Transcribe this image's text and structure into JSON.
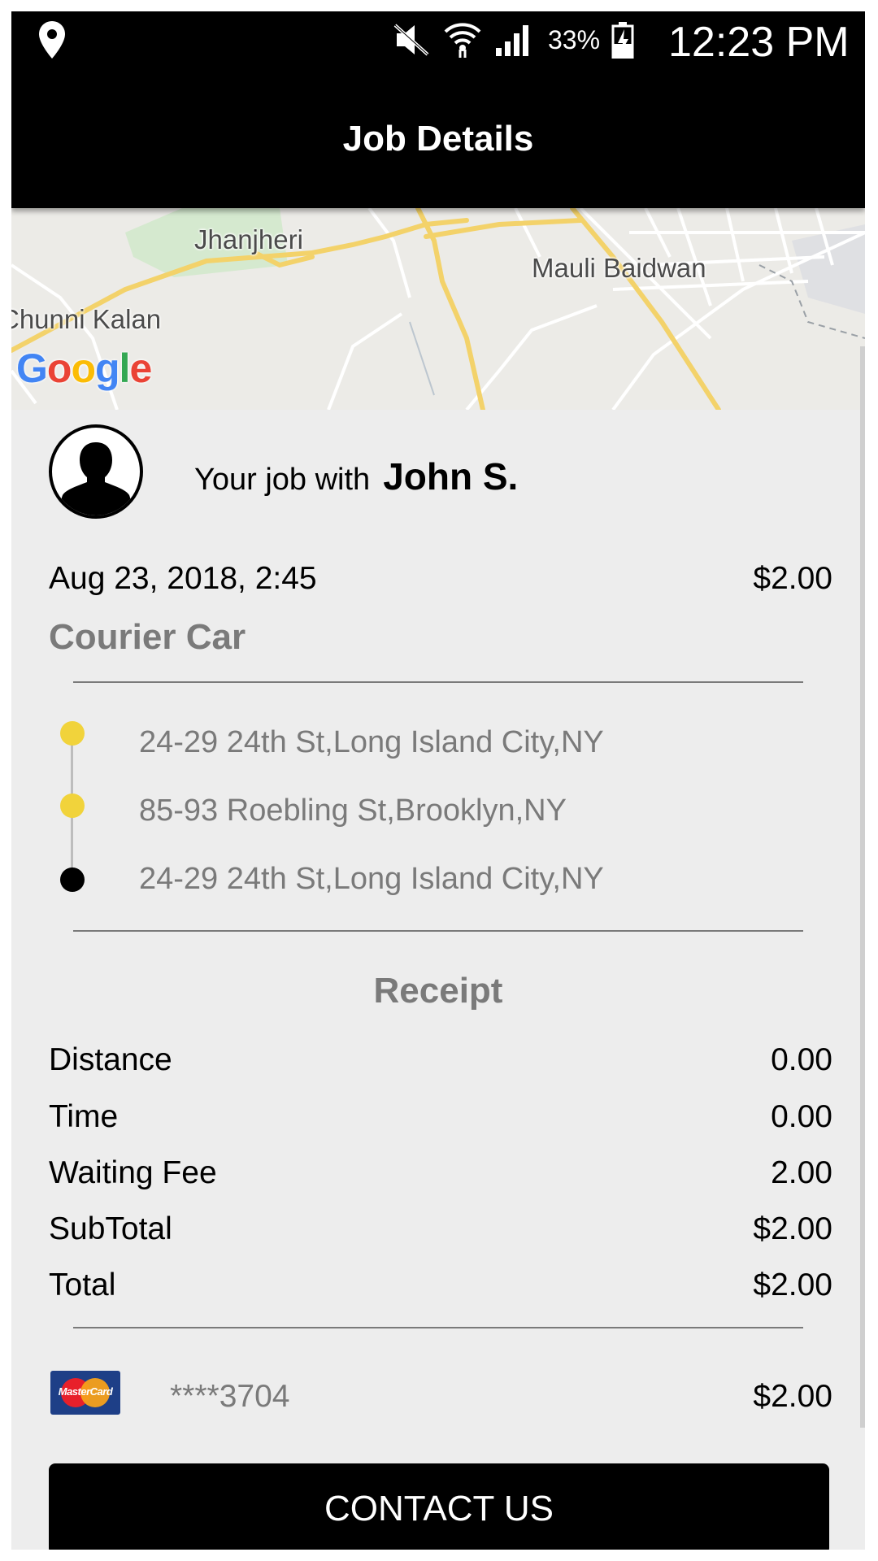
{
  "status_bar": {
    "battery": "33%",
    "time": "12:23 PM",
    "icons": [
      "location-icon",
      "mute-icon",
      "wifi-icon",
      "signal-icon",
      "battery-icon"
    ]
  },
  "app_bar": {
    "title": "Job Details"
  },
  "map": {
    "labels": {
      "place1": "Jhanjheri",
      "place2": "Mauli Baidwan",
      "place3": "Chunni Kalan"
    },
    "google": {
      "g1": "G",
      "o1": "o",
      "o2": "o",
      "g2": "g",
      "l": "l",
      "e": "e"
    }
  },
  "job": {
    "prefix": "Your job with",
    "driver_name": "John S.",
    "date": "Aug 23, 2018, 2:45",
    "price": "$2.00",
    "vehicle": "Courier Car"
  },
  "route": {
    "stops": [
      {
        "address": "24-29 24th St,Long Island City,NY",
        "color": "#f1d33b"
      },
      {
        "address": "85-93 Roebling St,Brooklyn,NY",
        "color": "#f1d33b"
      },
      {
        "address": "24-29 24th St,Long Island City,NY",
        "color": "#000000"
      }
    ]
  },
  "receipt": {
    "title": "Receipt",
    "rows": [
      {
        "label": "Distance",
        "value": "0.00"
      },
      {
        "label": "Time",
        "value": "0.00"
      },
      {
        "label": "Waiting Fee",
        "value": "2.00"
      },
      {
        "label": "SubTotal",
        "value": "$2.00"
      },
      {
        "label": "Total",
        "value": "$2.00"
      }
    ]
  },
  "payment": {
    "card_brand": "MasterCard",
    "card_number": "****3704",
    "amount": "$2.00"
  },
  "contact_button": {
    "label": "CONTACT US"
  },
  "colors": {
    "accent_yellow": "#f1d33b",
    "secondary_text": "#7a7a7a",
    "background": "#ededed"
  }
}
